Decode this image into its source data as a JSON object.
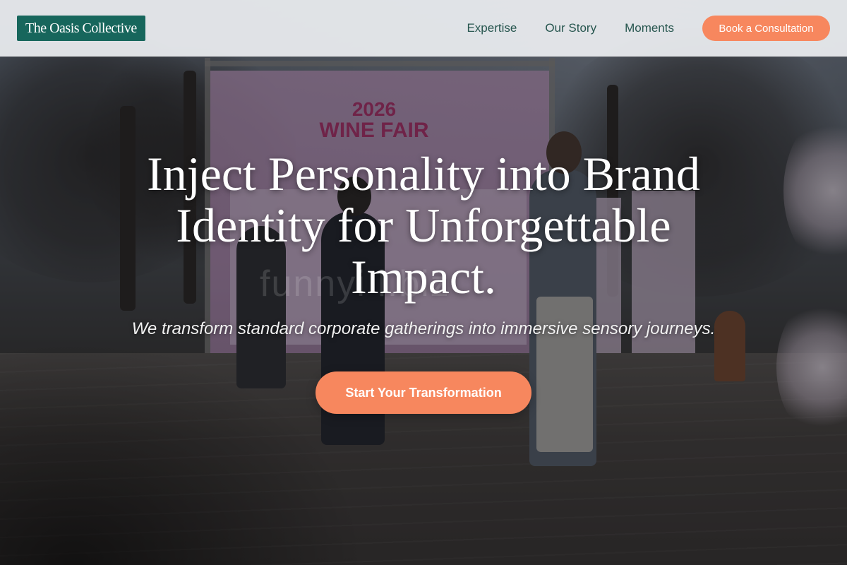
{
  "header": {
    "logo_text": "The Oasis Collective",
    "nav": [
      {
        "label": "Expertise"
      },
      {
        "label": "Our Story"
      },
      {
        "label": "Moments"
      }
    ],
    "cta_label": "Book a Consultation"
  },
  "hero": {
    "title": "Inject Personality into Brand Identity for Unforgettable Impact.",
    "subtitle": "We transform standard corporate gatherings into immersive sensory journeys.",
    "cta_label": "Start Your Transformation",
    "background": {
      "banner_year": "2026",
      "banner_event": "WINE FAIR",
      "watermark": "funnyi l.biz"
    }
  },
  "colors": {
    "brand_green": "#17665c",
    "nav_text": "#27564f",
    "accent_orange": "#f7875e",
    "header_bg": "#eceef1"
  }
}
